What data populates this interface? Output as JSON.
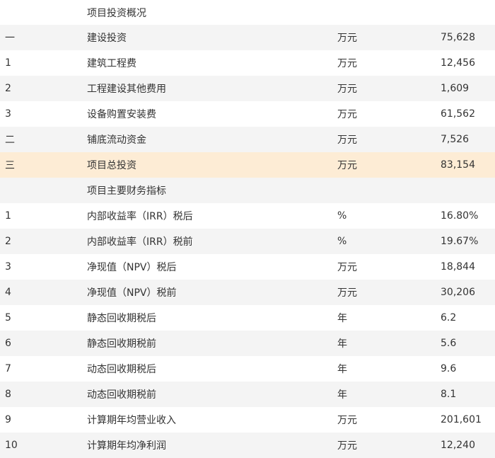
{
  "rows": [
    {
      "idx": "",
      "name": "项目投资概况",
      "unit": "",
      "value": "",
      "style": "plain"
    },
    {
      "idx": "一",
      "name": "建设投资",
      "unit": "万元",
      "value": "75,628",
      "style": "shaded"
    },
    {
      "idx": "1",
      "name": "建筑工程费",
      "unit": "万元",
      "value": "12,456",
      "style": "plain"
    },
    {
      "idx": "2",
      "name": "工程建设其他费用",
      "unit": "万元",
      "value": "1,609",
      "style": "shaded"
    },
    {
      "idx": "3",
      "name": "设备购置安装费",
      "unit": "万元",
      "value": "61,562",
      "style": "plain"
    },
    {
      "idx": "二",
      "name": "铺底流动资金",
      "unit": "万元",
      "value": "7,526",
      "style": "shaded"
    },
    {
      "idx": "三",
      "name": "项目总投资",
      "unit": "万元",
      "value": "83,154",
      "style": "highlight"
    },
    {
      "idx": "",
      "name": "项目主要财务指标",
      "unit": "",
      "value": "",
      "style": "shaded"
    },
    {
      "idx": "1",
      "name": "内部收益率（IRR）税后",
      "unit": "%",
      "value": "16.80%",
      "style": "plain"
    },
    {
      "idx": "2",
      "name": "内部收益率（IRR）税前",
      "unit": "%",
      "value": "19.67%",
      "style": "shaded"
    },
    {
      "idx": "3",
      "name": "净现值（NPV）税后",
      "unit": "万元",
      "value": "18,844",
      "style": "plain"
    },
    {
      "idx": "4",
      "name": "净现值（NPV）税前",
      "unit": "万元",
      "value": "30,206",
      "style": "shaded"
    },
    {
      "idx": "5",
      "name": "静态回收期税后",
      "unit": "年",
      "value": "6.2",
      "style": "plain"
    },
    {
      "idx": "6",
      "name": "静态回收期税前",
      "unit": "年",
      "value": "5.6",
      "style": "shaded"
    },
    {
      "idx": "7",
      "name": "动态回收期税后",
      "unit": "年",
      "value": "9.6",
      "style": "plain"
    },
    {
      "idx": "8",
      "name": "动态回收期税前",
      "unit": "年",
      "value": "8.1",
      "style": "shaded"
    },
    {
      "idx": "9",
      "name": "计算期年均营业收入",
      "unit": "万元",
      "value": "201,601",
      "style": "plain"
    },
    {
      "idx": "10",
      "name": "计算期年均净利润",
      "unit": "万元",
      "value": "12,240",
      "style": "shaded"
    }
  ],
  "colors": {
    "text": "#333333",
    "row_shaded": "#f4f4f4",
    "row_highlight": "#fdecd5",
    "background": "#ffffff"
  }
}
